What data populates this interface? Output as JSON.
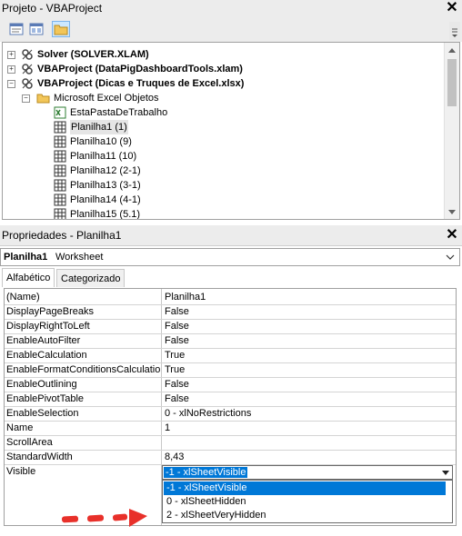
{
  "project_panel": {
    "title": "Projeto - VBAProject",
    "toolbar": {
      "icons": [
        "view-code-icon",
        "view-object-icon",
        "toggle-folders-icon"
      ]
    },
    "tree": [
      {
        "label": "Solver (SOLVER.XLAM)",
        "expander": "+",
        "bold": true,
        "icon": "vba-project-icon"
      },
      {
        "label": "VBAProject (DataPigDashboardTools.xlam)",
        "expander": "+",
        "bold": true,
        "icon": "vba-project-icon"
      },
      {
        "label": "VBAProject (Dicas e Truques de Excel.xlsx)",
        "expander": "-",
        "bold": true,
        "icon": "vba-project-icon"
      },
      {
        "label": "Microsoft Excel Objetos",
        "expander": "-",
        "bold": false,
        "icon": "folder-open-icon"
      },
      {
        "label": "EstaPastaDeTrabalho",
        "bold": false,
        "icon": "workbook-icon"
      },
      {
        "label": "Planilha1 (1)",
        "bold": false,
        "icon": "worksheet-icon",
        "selected": true
      },
      {
        "label": "Planilha10 (9)",
        "bold": false,
        "icon": "worksheet-icon"
      },
      {
        "label": "Planilha11 (10)",
        "bold": false,
        "icon": "worksheet-icon"
      },
      {
        "label": "Planilha12 (2-1)",
        "bold": false,
        "icon": "worksheet-icon"
      },
      {
        "label": "Planilha13 (3-1)",
        "bold": false,
        "icon": "worksheet-icon"
      },
      {
        "label": "Planilha14 (4-1)",
        "bold": false,
        "icon": "worksheet-icon"
      },
      {
        "label": "Planilha15 (5.1)",
        "bold": false,
        "icon": "worksheet-icon"
      }
    ]
  },
  "properties_panel": {
    "title": "Propriedades - Planilha1",
    "object_name": "Planilha1",
    "object_type": "Worksheet",
    "tabs": [
      "Alfabético",
      "Categorizado"
    ],
    "active_tab": "Alfabético",
    "rows": [
      {
        "name": "(Name)",
        "value": "Planilha1"
      },
      {
        "name": "DisplayPageBreaks",
        "value": "False"
      },
      {
        "name": "DisplayRightToLeft",
        "value": "False"
      },
      {
        "name": "EnableAutoFilter",
        "value": "False"
      },
      {
        "name": "EnableCalculation",
        "value": "True"
      },
      {
        "name": "EnableFormatConditionsCalculation",
        "value": "True"
      },
      {
        "name": "EnableOutlining",
        "value": "False"
      },
      {
        "name": "EnablePivotTable",
        "value": "False"
      },
      {
        "name": "EnableSelection",
        "value": "0 - xlNoRestrictions"
      },
      {
        "name": "Name",
        "value": "1"
      },
      {
        "name": "ScrollArea",
        "value": ""
      },
      {
        "name": "StandardWidth",
        "value": "8,43"
      },
      {
        "name": "Visible",
        "value": ""
      }
    ],
    "visible_combo": {
      "selected": "-1 - xlSheetVisible",
      "options": [
        "-1 - xlSheetVisible",
        "0 - xlSheetHidden",
        "2 - xlSheetVeryHidden"
      ]
    }
  },
  "colors": {
    "selection": "#0078d7",
    "annotation_arrow": "#e8302a",
    "panel_bg": "#ececec"
  }
}
